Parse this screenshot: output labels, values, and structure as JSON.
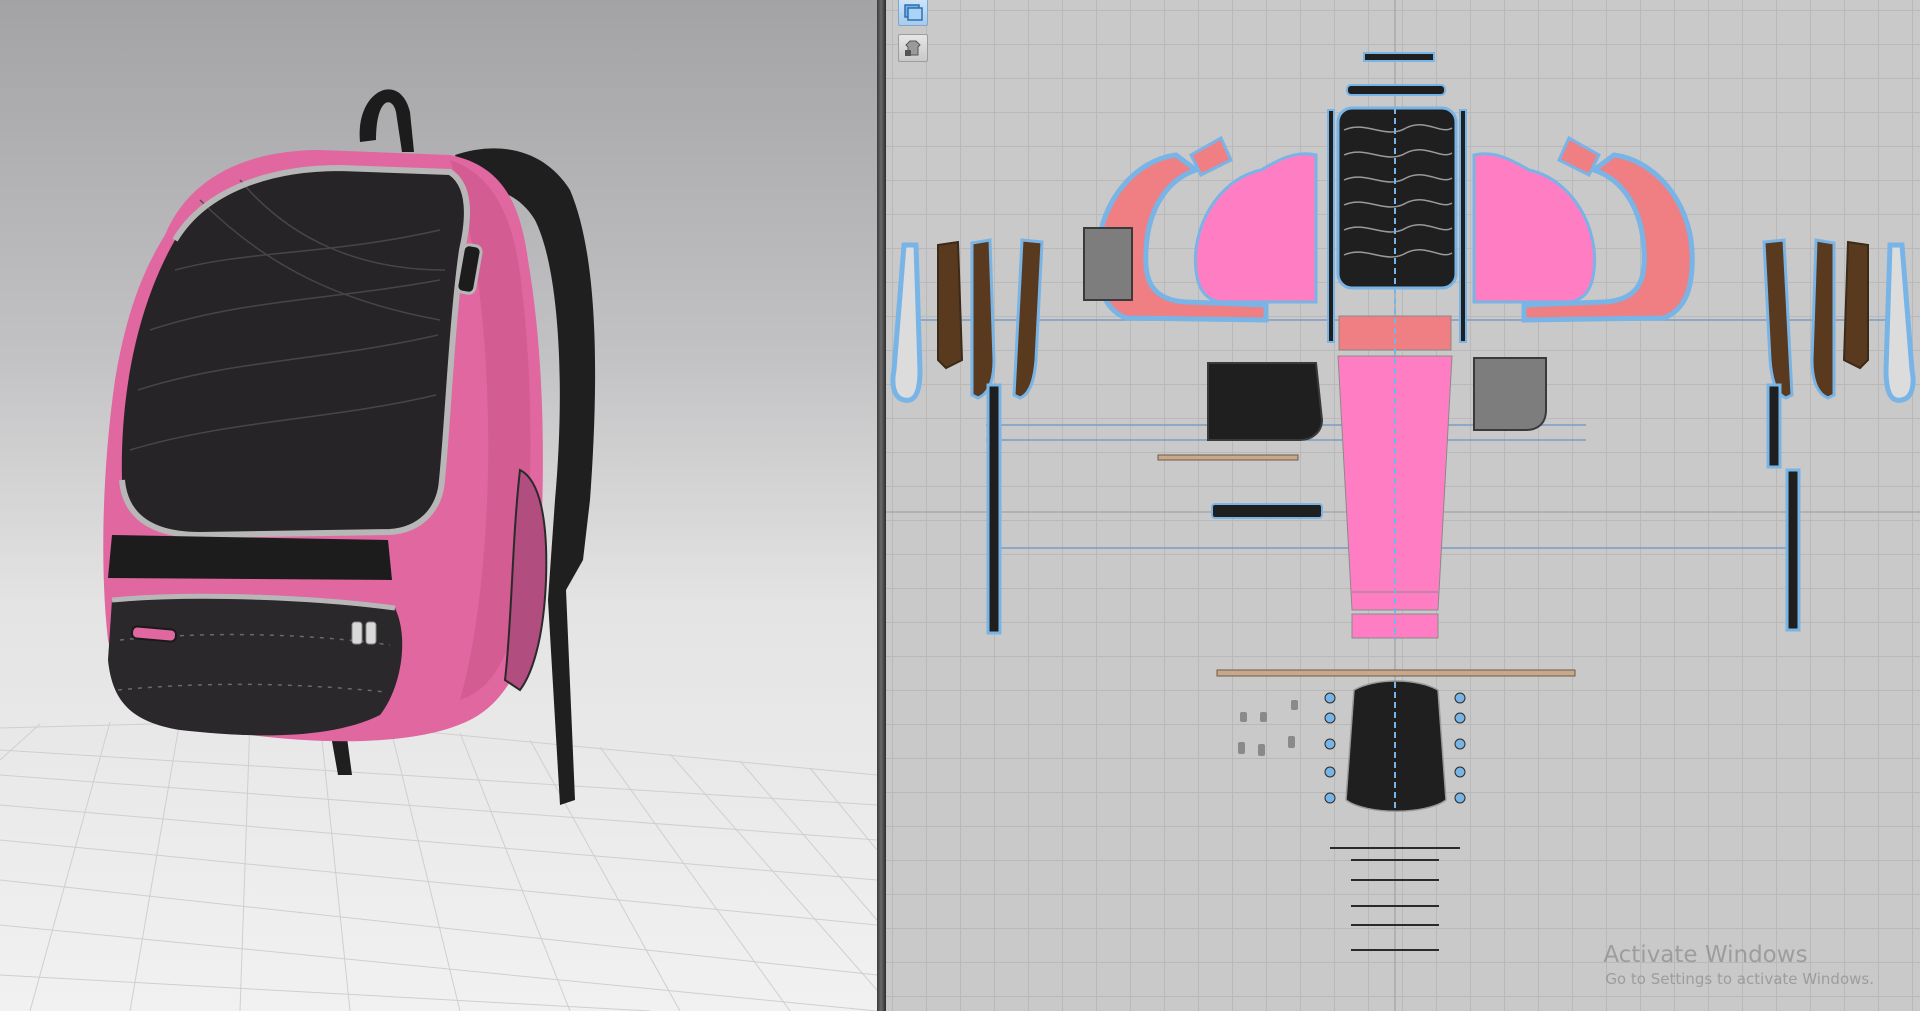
{
  "viewport_3d": {
    "object": "pink-black-backpack",
    "colors": {
      "body_pink": "#e0679f",
      "panel_black": "#262426",
      "zipper_grey": "#b7b7b7",
      "floor": "#efefef"
    }
  },
  "pattern_window": {
    "toolbar": {
      "icons": [
        "show-3d-garment-icon",
        "locked-garment-icon"
      ]
    },
    "colors": {
      "pink_piece": "#ff7ec3",
      "salmon_piece": "#ef7f83",
      "black_piece": "#1f1f1f",
      "brown_piece": "#5a3a1e",
      "tan_piece": "#c7a88a",
      "grey_piece": "#7d7d7d",
      "selection_outline": "#79b4e6",
      "grid": "#b9b9b9"
    }
  },
  "watermark": {
    "title": "Activate Windows",
    "subtitle": "Go to Settings to activate Windows."
  }
}
